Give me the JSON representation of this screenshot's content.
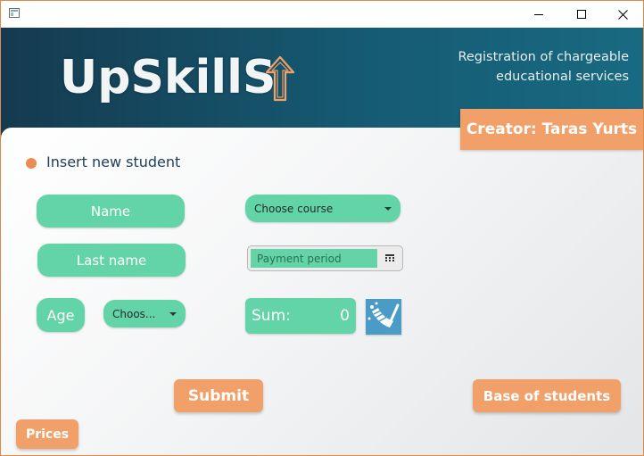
{
  "window": {
    "controls": [
      "minimize",
      "maximize",
      "close"
    ]
  },
  "header": {
    "logo": "UpSkillS",
    "registration_line1": "Registration of chargeable",
    "registration_line2": "educational services",
    "creator": "Creator: Taras Yurts"
  },
  "form": {
    "section_title": "Insert new student",
    "name_label": "Name",
    "last_name_label": "Last name",
    "age_label": "Age",
    "age_select": "Choos...",
    "course_select": "Choose course",
    "payment_period_placeholder": "Payment period",
    "sum_label": "Sum:",
    "sum_value": "0"
  },
  "actions": {
    "submit": "Submit",
    "base_of_students": "Base of students",
    "prices": "Prices"
  },
  "colors": {
    "header_dark": "#153a4f",
    "header_light": "#186a82",
    "accent_green": "#63d3a8",
    "accent_orange": "#f2a06a",
    "section_dot": "#ec8b53",
    "clear_button": "#4a9bc6"
  },
  "icons": [
    "app-window-icon",
    "minimize-icon",
    "maximize-icon",
    "close-icon",
    "upload-arrow-icon",
    "calendar-icon",
    "broom-clear-icon",
    "chevron-down-icon"
  ]
}
